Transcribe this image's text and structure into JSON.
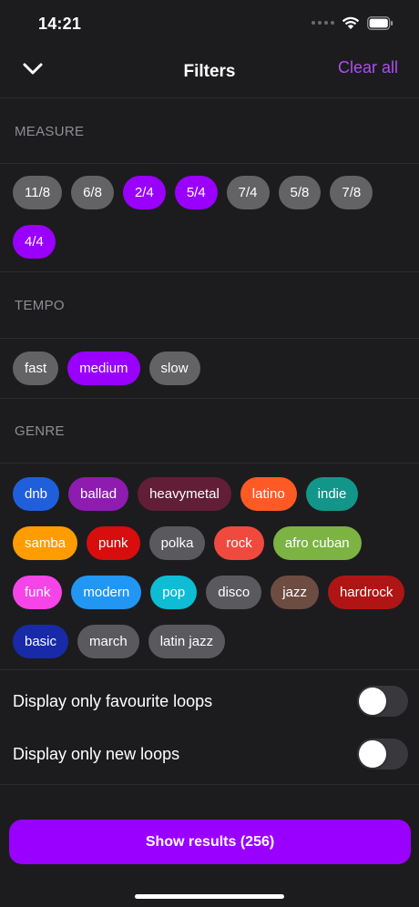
{
  "status_bar": {
    "time": "14:21"
  },
  "header": {
    "title": "Filters",
    "clear_label": "Clear all"
  },
  "colors": {
    "accent": "#9a00ff",
    "accent_text": "#b04df2",
    "chip_default": "#636366"
  },
  "measure": {
    "label": "MEASURE",
    "chips": [
      {
        "label": "11/8",
        "selected": false,
        "color": "#636366"
      },
      {
        "label": "6/8",
        "selected": false,
        "color": "#636366"
      },
      {
        "label": "2/4",
        "selected": true,
        "color": "#9a00ff"
      },
      {
        "label": "5/4",
        "selected": true,
        "color": "#9a00ff"
      },
      {
        "label": "7/4",
        "selected": false,
        "color": "#636366"
      },
      {
        "label": "5/8",
        "selected": false,
        "color": "#636366"
      },
      {
        "label": "7/8",
        "selected": false,
        "color": "#636366"
      },
      {
        "label": "4/4",
        "selected": true,
        "color": "#9a00ff"
      }
    ]
  },
  "tempo": {
    "label": "TEMPO",
    "chips": [
      {
        "label": "fast",
        "selected": false,
        "color": "#636366"
      },
      {
        "label": "medium",
        "selected": true,
        "color": "#9a00ff"
      },
      {
        "label": "slow",
        "selected": false,
        "color": "#636366"
      }
    ]
  },
  "genre": {
    "label": "GENRE",
    "chips": [
      {
        "label": "dnb",
        "color": "#1f5fdc"
      },
      {
        "label": "ballad",
        "color": "#8e1cb0"
      },
      {
        "label": "heavymetal",
        "color": "#611e36"
      },
      {
        "label": "latino",
        "color": "#ff5a24"
      },
      {
        "label": "indie",
        "color": "#12968a"
      },
      {
        "label": "samba",
        "color": "#ff9d00"
      },
      {
        "label": "punk",
        "color": "#d80d0d"
      },
      {
        "label": "polka",
        "color": "#5a5a5e"
      },
      {
        "label": "rock",
        "color": "#f04a3f"
      },
      {
        "label": "afro cuban",
        "color": "#7cb342"
      },
      {
        "label": "funk",
        "color": "#f545e8"
      },
      {
        "label": "modern",
        "color": "#2196f3"
      },
      {
        "label": "pop",
        "color": "#0ebcd4"
      },
      {
        "label": "disco",
        "color": "#5a5a5e"
      },
      {
        "label": "jazz",
        "color": "#6d4c41"
      },
      {
        "label": "hardrock",
        "color": "#b01515"
      },
      {
        "label": "basic",
        "color": "#182aa8"
      },
      {
        "label": "march",
        "color": "#5a5a5e"
      },
      {
        "label": "latin jazz",
        "color": "#5a5a5e"
      }
    ]
  },
  "toggles": [
    {
      "label": "Display only favourite loops",
      "on": false
    },
    {
      "label": "Display only new loops",
      "on": false
    }
  ],
  "footer": {
    "button_label": "Show results (256)"
  }
}
